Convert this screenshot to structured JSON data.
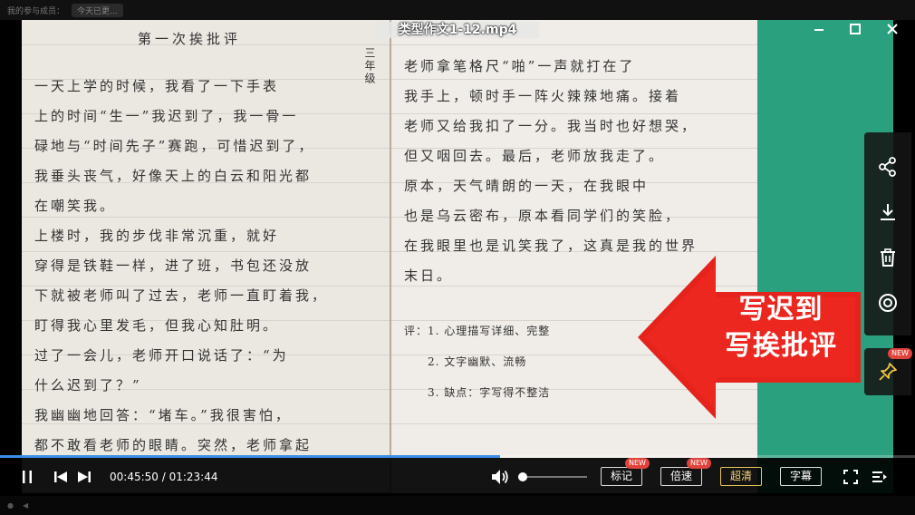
{
  "window": {
    "title": "类型作文1-12.mp4"
  },
  "topbar": {
    "label": "我的参与成员：",
    "tag": "今天已更..."
  },
  "video": {
    "overlay_text_line1": "写迟到",
    "overlay_text_line2": "写挨批评",
    "handwriting_left": {
      "title": "第一次挨批评",
      "side_note": "三年级",
      "lines": [
        "一天上学的时候，我看了一下手表",
        "上的时间“生一”我迟到了，我一骨一",
        "碌地与“时间先子”赛跑，可惜迟到了，",
        "我垂头丧气，好像天上的白云和阳光都",
        "在嘲笑我。",
        "上楼时，我的步伐非常沉重，就好",
        "穿得是铁鞋一样，进了班，书包还没放",
        "下就被老师叫了过去，老师一直盯着我，",
        "盯得我心里发毛，但我心知肚明。",
        "过了一会儿，老师开口说话了：“为",
        "什么迟到了？”",
        "我幽幽地回答：“堵车。”我很害怕，",
        "都不敢看老师的眼睛。突然，老师拿起"
      ]
    },
    "handwriting_right": {
      "lines": [
        "老师拿笔格尺“啪”一声就打在了",
        "我手上，顿时手一阵火辣辣地痛。接着",
        "老师又给我扣了一分。我当时也好想哭，",
        "但又咽回去。最后，老师放我走了。",
        "原本，天气晴朗的一天，在我眼中",
        "也是乌云密布，原本看同学们的笑脸，",
        "在我眼里也是讥笑我了，这真是我的世界",
        "末日。"
      ],
      "notes": [
        "评：1. 心理描写详细、完整",
        "2. 文字幽默、流畅",
        "3. 缺点：字写得不整洁"
      ]
    }
  },
  "sidepanel": {
    "items": [
      "share-icon",
      "download-icon",
      "delete-icon",
      "screenshot-icon"
    ],
    "pin_badge": "NEW"
  },
  "playback": {
    "current_time": "00:45:50",
    "separator": " / ",
    "total_time": "01:23:44",
    "progress_fraction": 0.547,
    "volume_fraction": 0.06
  },
  "buttons": {
    "mark": "标记",
    "mark_badge": "NEW",
    "speed": "倍速",
    "speed_badge": "NEW",
    "quality": "超清",
    "subtitle": "字幕"
  },
  "colors": {
    "progress": "#3a8ee6",
    "quality_active": "#e8c45a",
    "badge": "#e0433c",
    "arrow_red": "#e5231c"
  }
}
